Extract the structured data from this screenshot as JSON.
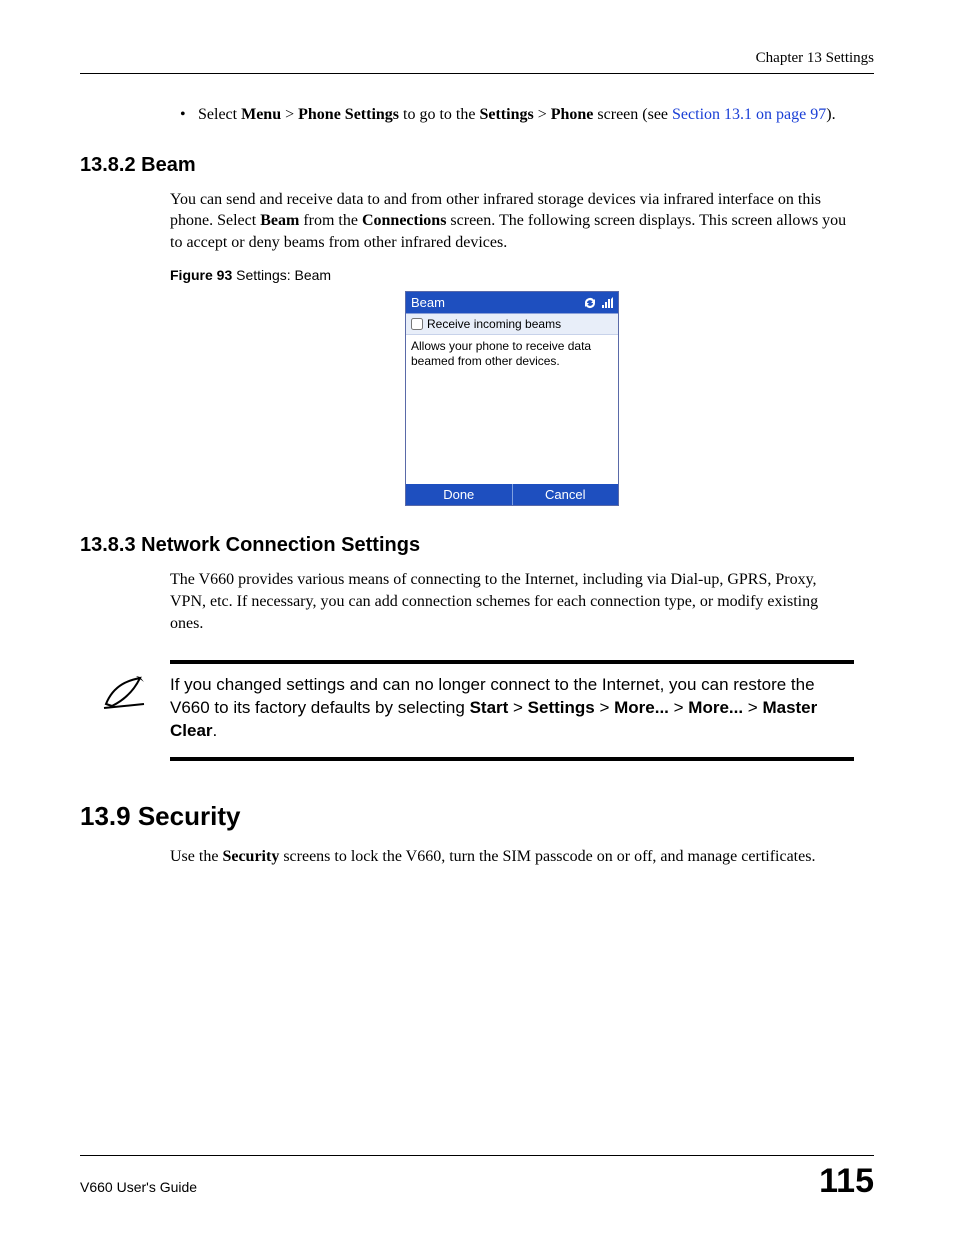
{
  "header": {
    "chapter": "Chapter 13 Settings"
  },
  "bullet": {
    "pre": "Select ",
    "b1": "Menu",
    "gt1": " > ",
    "b2": "Phone Settings",
    "mid": " to go to the ",
    "b3": "Settings",
    "gt2": " > ",
    "b4": "Phone",
    "post1": " screen (see ",
    "link": "Section 13.1 on page 97",
    "post2": ")."
  },
  "sec1382": {
    "heading": "13.8.2  Beam",
    "p_pre": "You can send and receive data to and from other infrared storage devices via infrared interface on this phone. Select ",
    "p_b1": "Beam",
    "p_mid": " from the ",
    "p_b2": "Connections",
    "p_post": " screen. The following screen displays. This screen allows you to accept or deny beams from other infrared devices.",
    "fig_b": "Figure 93",
    "fig_t": "   Settings: Beam"
  },
  "phone": {
    "title": "Beam",
    "checkbox_label": "Receive incoming beams",
    "desc": "Allows your phone to receive data beamed from other devices.",
    "sk_left": "Done",
    "sk_right": "Cancel"
  },
  "sec1383": {
    "heading": "13.8.3  Network Connection Settings",
    "p": "The V660 provides various means of connecting to the Internet, including via  Dial-up, GPRS, Proxy, VPN, etc. If necessary, you can add connection schemes for each connection type, or modify existing ones."
  },
  "note": {
    "t1": "If you changed settings and can no longer connect to the Internet, you can restore the V660 to its factory defaults by selecting ",
    "b1": "Start",
    "gt": " > ",
    "b2": "Settings",
    "b3": "More...",
    "b4": "More...",
    "b5": "Master Clear",
    "end": "."
  },
  "sec139": {
    "heading": "13.9  Security",
    "p_pre": "Use the ",
    "p_b1": "Security",
    "p_post": " screens to lock the V660, turn the SIM passcode on or off, and manage certificates."
  },
  "footer": {
    "guide": "V660 User's Guide",
    "page": "115"
  }
}
